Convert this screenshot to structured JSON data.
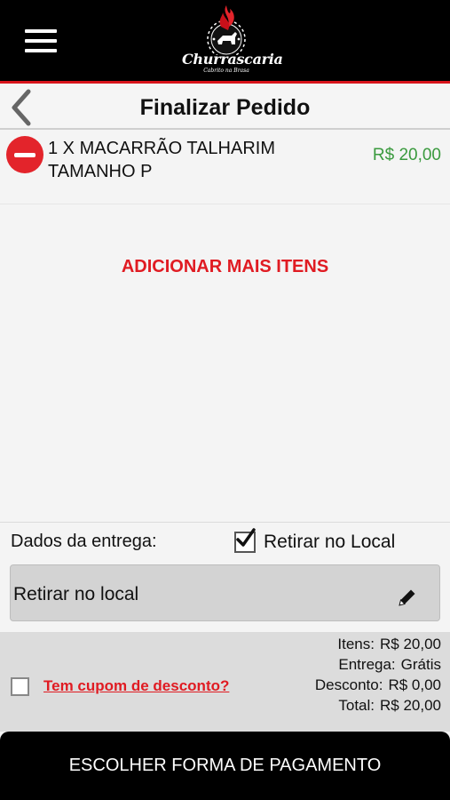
{
  "app": {
    "logo_title": "Churrascaria",
    "logo_subtitle": "Cabrito na Brasa"
  },
  "header": {
    "title": "Finalizar Pedido"
  },
  "order": {
    "items": [
      {
        "quantity_label": "1 X MACARRÃO TALHARIM TAMANHO P",
        "price": "R$ 20,00"
      }
    ],
    "add_more_label": "ADICIONAR MAIS ITENS"
  },
  "delivery": {
    "label": "Dados da entrega:",
    "pickup_label": "Retirar no Local",
    "pickup_checked": true,
    "address_value": "Retirar no local"
  },
  "coupon": {
    "label": "Tem cupom de desconto?",
    "checked": false
  },
  "totals": {
    "items_label": "Itens:",
    "items_value": "R$ 20,00",
    "delivery_label": "Entrega:",
    "delivery_value": "Grátis",
    "discount_label": "Desconto:",
    "discount_value": "R$ 0,00",
    "total_label": "Total:",
    "total_value": "R$ 20,00"
  },
  "payment_button": {
    "label": "ESCOLHER FORMA DE PAGAMENTO"
  },
  "colors": {
    "accent_red": "#e01b22",
    "price_green": "#3a9a3e",
    "topbar": "#000000"
  },
  "icons": [
    "menu-icon",
    "flame-logo-icon",
    "back-chevron-icon",
    "remove-icon",
    "checkbox-checked-icon",
    "pencil-icon",
    "checkbox-empty-icon"
  ]
}
